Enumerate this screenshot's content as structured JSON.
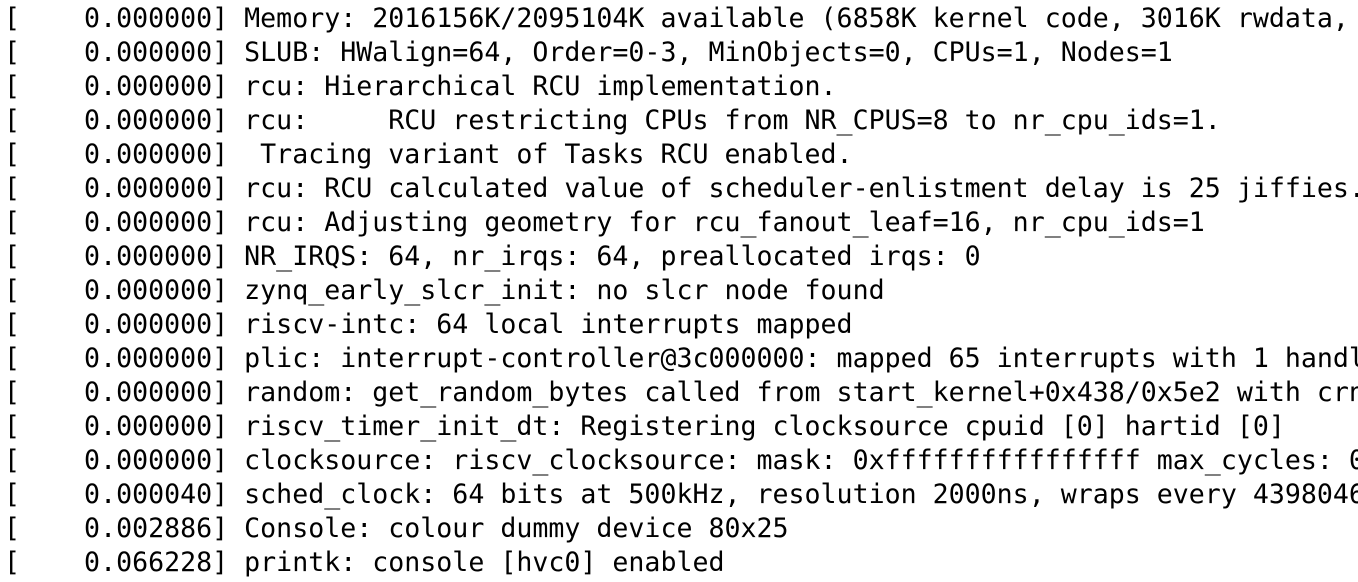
{
  "terminal": {
    "lines": [
      "[    0.000000] Memory: 2016156K/2095104K available (6858K kernel code, 3016K rwdata,",
      "[    0.000000] SLUB: HWalign=64, Order=0-3, MinObjects=0, CPUs=1, Nodes=1",
      "[    0.000000] rcu: Hierarchical RCU implementation.",
      "[    0.000000] rcu:     RCU restricting CPUs from NR_CPUS=8 to nr_cpu_ids=1.",
      "[    0.000000]  Tracing variant of Tasks RCU enabled.",
      "[    0.000000] rcu: RCU calculated value of scheduler-enlistment delay is 25 jiffies.",
      "[    0.000000] rcu: Adjusting geometry for rcu_fanout_leaf=16, nr_cpu_ids=1",
      "[    0.000000] NR_IRQS: 64, nr_irqs: 64, preallocated irqs: 0",
      "[    0.000000] zynq_early_slcr_init: no slcr node found",
      "[    0.000000] riscv-intc: 64 local interrupts mapped",
      "[    0.000000] plic: interrupt-controller@3c000000: mapped 65 interrupts with 1 handl",
      "[    0.000000] random: get_random_bytes called from start_kernel+0x438/0x5e2 with crn",
      "[    0.000000] riscv_timer_init_dt: Registering clocksource cpuid [0] hartid [0]",
      "[    0.000000] clocksource: riscv_clocksource: mask: 0xffffffffffffffff max_cycles: 0",
      "[    0.000040] sched_clock: 64 bits at 500kHz, resolution 2000ns, wraps every 4398046",
      "[    0.002886] Console: colour dummy device 80x25",
      "[    0.066228] printk: console [hvc0] enabled"
    ]
  }
}
